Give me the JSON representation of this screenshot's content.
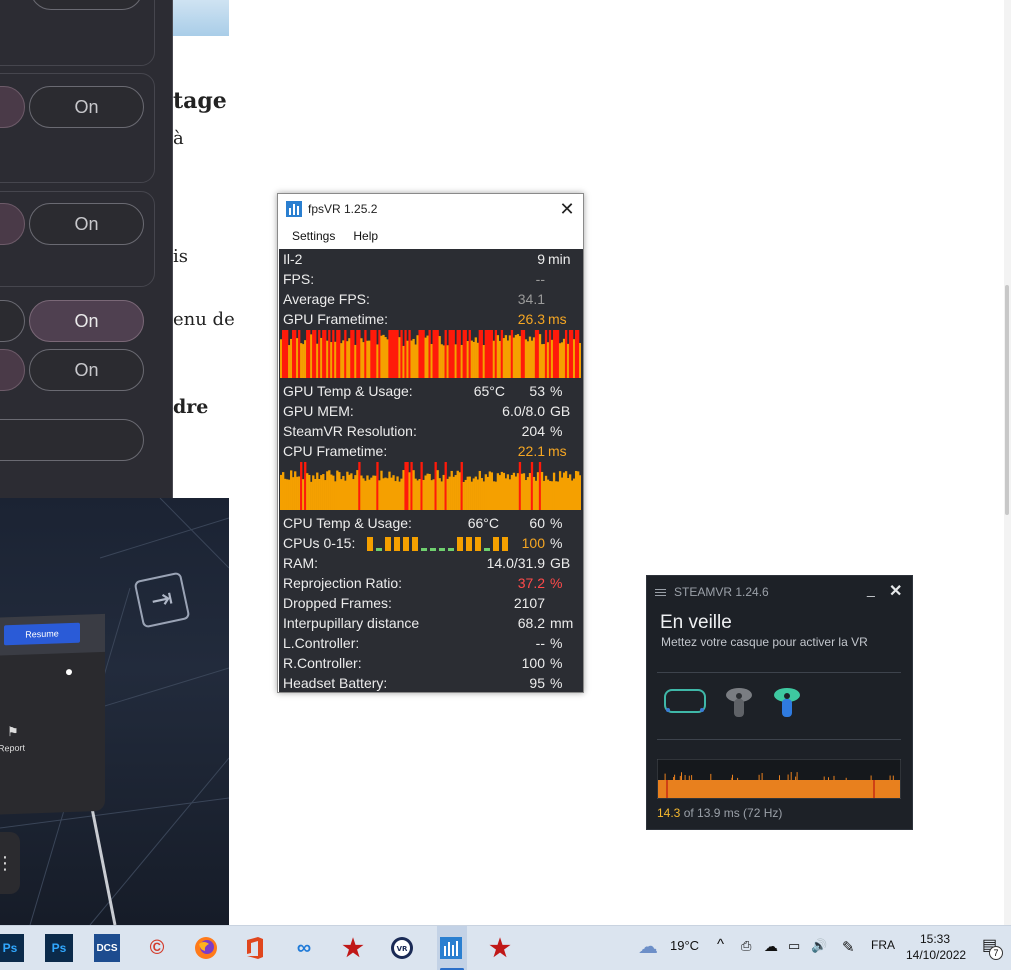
{
  "left_panel": {
    "toggle_rows": [
      {
        "label": "On",
        "state": "off"
      },
      {
        "label": "On",
        "state": "off"
      },
      {
        "label": "On",
        "state": "on"
      },
      {
        "label": "On",
        "state": "off"
      }
    ]
  },
  "article": {
    "heading_fragment": "tage",
    "line1": "à",
    "line2": "is",
    "line3": "enu de",
    "heading2_fragment": "dre"
  },
  "vr": {
    "resume_label": "Resume",
    "report_label": "Report"
  },
  "fpsvr": {
    "title": "fpsVR 1.25.2",
    "menu": [
      "Settings",
      "Help"
    ],
    "rows": {
      "game": {
        "label": "Il-2",
        "value": "9",
        "unit": "min"
      },
      "fps": {
        "label": "FPS:",
        "value": "--"
      },
      "avg_fps": {
        "label": "Average FPS:",
        "value": "34.1"
      },
      "gpu_frametime": {
        "label": "GPU Frametime:",
        "value": "26.3",
        "unit": "ms"
      },
      "gpu_temp": {
        "label": "GPU Temp & Usage:",
        "value": "65°C",
        "value2": "53",
        "unit": "%"
      },
      "gpu_mem": {
        "label": "GPU MEM:",
        "value": "6.0/8.0",
        "unit": "GB"
      },
      "steamvr_res": {
        "label": "SteamVR Resolution:",
        "value": "204",
        "unit": "%"
      },
      "cpu_frametime": {
        "label": "CPU Frametime:",
        "value": "22.1",
        "unit": "ms"
      },
      "cpu_temp": {
        "label": "CPU Temp & Usage:",
        "value": "66°C",
        "value2": "60",
        "unit": "%"
      },
      "cpus": {
        "label": "CPUs 0-15:",
        "value": "100",
        "unit": "%"
      },
      "ram": {
        "label": "RAM:",
        "value": "14.0/31.9",
        "unit": "GB"
      },
      "reprojection": {
        "label": "Reprojection Ratio:",
        "value": "37.2",
        "unit": "%"
      },
      "dropped": {
        "label": "Dropped Frames:",
        "value": "2107"
      },
      "ipd": {
        "label": "Interpupillary distance",
        "value": "68.2",
        "unit": "mm"
      },
      "lcontroller": {
        "label": "L.Controller:",
        "value": "--",
        "unit": "%"
      },
      "rcontroller": {
        "label": "R.Controller:",
        "value": "100",
        "unit": "%"
      },
      "battery": {
        "label": "Headset Battery:",
        "value": "95",
        "unit": "%"
      }
    }
  },
  "steamvr": {
    "title": "STEAMVR 1.24.6",
    "status": "En veille",
    "hint": "Mettez votre casque pour activer la VR",
    "timing_current": "14.3",
    "timing_rest": " of 13.9 ms (72 Hz)"
  },
  "taskbar": {
    "apps": [
      "Ps",
      "Ps",
      "DCS",
      "CCleaner",
      "Firefox",
      "Office",
      "Oculus",
      "Red Star",
      "VR",
      "fpsVR",
      "Red Star"
    ],
    "weather": "19°C",
    "language": "FRA",
    "time": "15:33",
    "date": "14/10/2022",
    "notifications": "7"
  },
  "colors": {
    "accent_orange": "#f5a623",
    "alert_red": "#ff4a4a",
    "steam_orange": "#e8801e"
  }
}
